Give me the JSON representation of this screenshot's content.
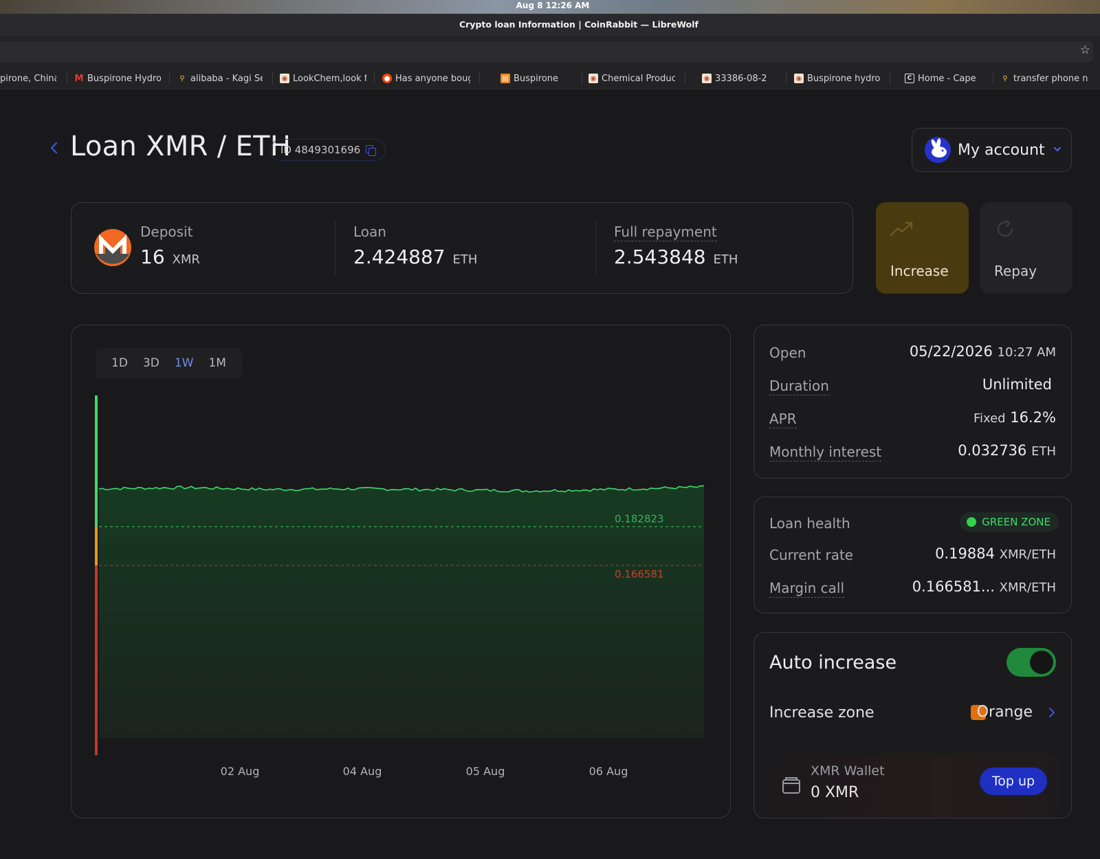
{
  "os": {
    "clock": "Aug 8  12:26 AM"
  },
  "browser": {
    "window_title": "Crypto loan Information | CoinRabbit — LibreWolf",
    "bookmarks": [
      {
        "label": "pirone, China",
        "icon": "none"
      },
      {
        "label": "Buspirone Hydro",
        "icon": "m-icon"
      },
      {
        "label": "alibaba - Kagi Se",
        "icon": "search-icon"
      },
      {
        "label": "LookChem,look f",
        "icon": "lookchem-icon"
      },
      {
        "label": "Has anyone boug",
        "icon": "reddit-icon"
      },
      {
        "label": "Buspirone",
        "icon": "orange-site-icon"
      },
      {
        "label": "Chemical Produc",
        "icon": "lookchem-icon"
      },
      {
        "label": "33386-08-2",
        "icon": "lookchem-icon"
      },
      {
        "label": "Buspirone hydro",
        "icon": "lookchem-icon"
      },
      {
        "label": "Home - Cape",
        "icon": "c-icon"
      },
      {
        "label": "transfer phone n",
        "icon": "search-icon"
      }
    ]
  },
  "header": {
    "title": "Loan XMR / ETH",
    "loan_id": "ID 4849301696",
    "account_label": "My account"
  },
  "summary": {
    "deposit": {
      "label": "Deposit",
      "value": "16",
      "unit": "XMR"
    },
    "loan": {
      "label": "Loan",
      "value": "2.424887",
      "unit": "ETH"
    },
    "full_repayment": {
      "label": "Full repayment",
      "value": "2.543848",
      "unit": "ETH"
    }
  },
  "actions": {
    "increase": "Increase",
    "repay": "Repay"
  },
  "chart": {
    "ranges": [
      "1D",
      "3D",
      "1W",
      "1M"
    ],
    "active_range": "1W",
    "increase_level_label": "0.182823",
    "margin_call_label": "0.166581",
    "x_tick_labels": [
      "02 Aug",
      "04 Aug",
      "05 Aug",
      "06 Aug"
    ]
  },
  "chart_data": {
    "type": "area",
    "title": "",
    "xlabel": "",
    "ylabel": "",
    "categories": [
      "02 Aug",
      "04 Aug",
      "05 Aug",
      "06 Aug"
    ],
    "series": [
      {
        "values": [
          0.1987,
          0.1992,
          0.1984,
          0.1987,
          0.1983,
          0.1978,
          0.1985,
          0.1994
        ]
      }
    ],
    "reference_lines": [
      {
        "label": "0.182823",
        "value": 0.182823,
        "color": "#2fae4c",
        "style": "dashed"
      },
      {
        "label": "0.166581",
        "value": 0.166581,
        "color": "#b8321f",
        "style": "dashed"
      }
    ],
    "colors": {
      "line": "#3ddc6a",
      "fill": "#173a22",
      "margin_call": "#c0392b",
      "increase_zone": "#e39b1b"
    }
  },
  "details": {
    "open": {
      "label": "Open",
      "date": "05/22/2026",
      "time": "10:27 AM"
    },
    "duration": {
      "label": "Duration",
      "value": "Unlimited"
    },
    "apr": {
      "label": "APR",
      "prefix": "Fixed",
      "value": "16.2%"
    },
    "monthly_interest": {
      "label": "Monthly interest",
      "value": "0.032736",
      "unit": "ETH"
    }
  },
  "health": {
    "loan_health": {
      "label": "Loan health",
      "value": "GREEN ZONE"
    },
    "current_rate": {
      "label": "Current rate",
      "value": "0.19884",
      "unit": "XMR/ETH"
    },
    "margin_call": {
      "label": "Margin call",
      "value": "0.166581...",
      "unit": "XMR/ETH"
    }
  },
  "auto_increase": {
    "title": "Auto increase",
    "enabled": true,
    "zone_label": "Increase zone",
    "zone_value": "Orange",
    "wallet_label": "XMR Wallet",
    "wallet_balance": "0 XMR",
    "topup_label": "Top up"
  }
}
